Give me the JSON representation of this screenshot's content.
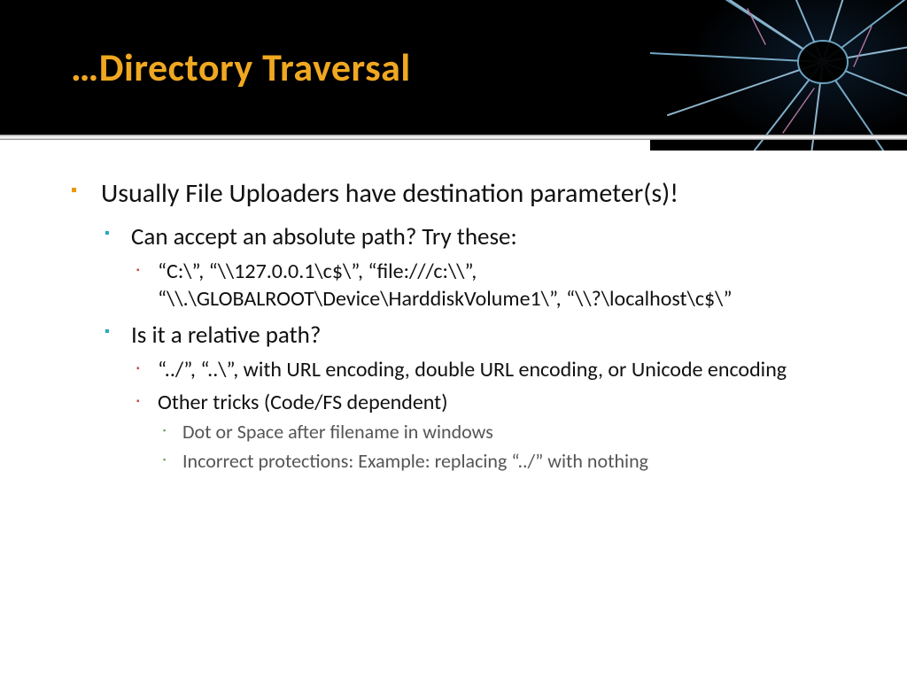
{
  "title": "…Directory Traversal",
  "content": {
    "l1": "Usually File Uploaders have destination parameter(s)!",
    "l2a": "Can accept an absolute path? Try these:",
    "l3a": "“C:\\”, “\\\\127.0.0.1\\c$\\”, “file:///c:\\\\”, “\\\\.\\GLOBALROOT\\Device\\HarddiskVolume1\\”, “\\\\?\\localhost\\c$\\”",
    "l2b": "Is it a relative path?",
    "l3b": "“../”, “..\\”, with URL encoding, double URL encoding, or Unicode encoding",
    "l3c": "Other tricks (Code/FS dependent)",
    "l4a": "Dot or Space after filename in windows",
    "l4b": "Incorrect protections: Example: replacing “../” with nothing"
  }
}
